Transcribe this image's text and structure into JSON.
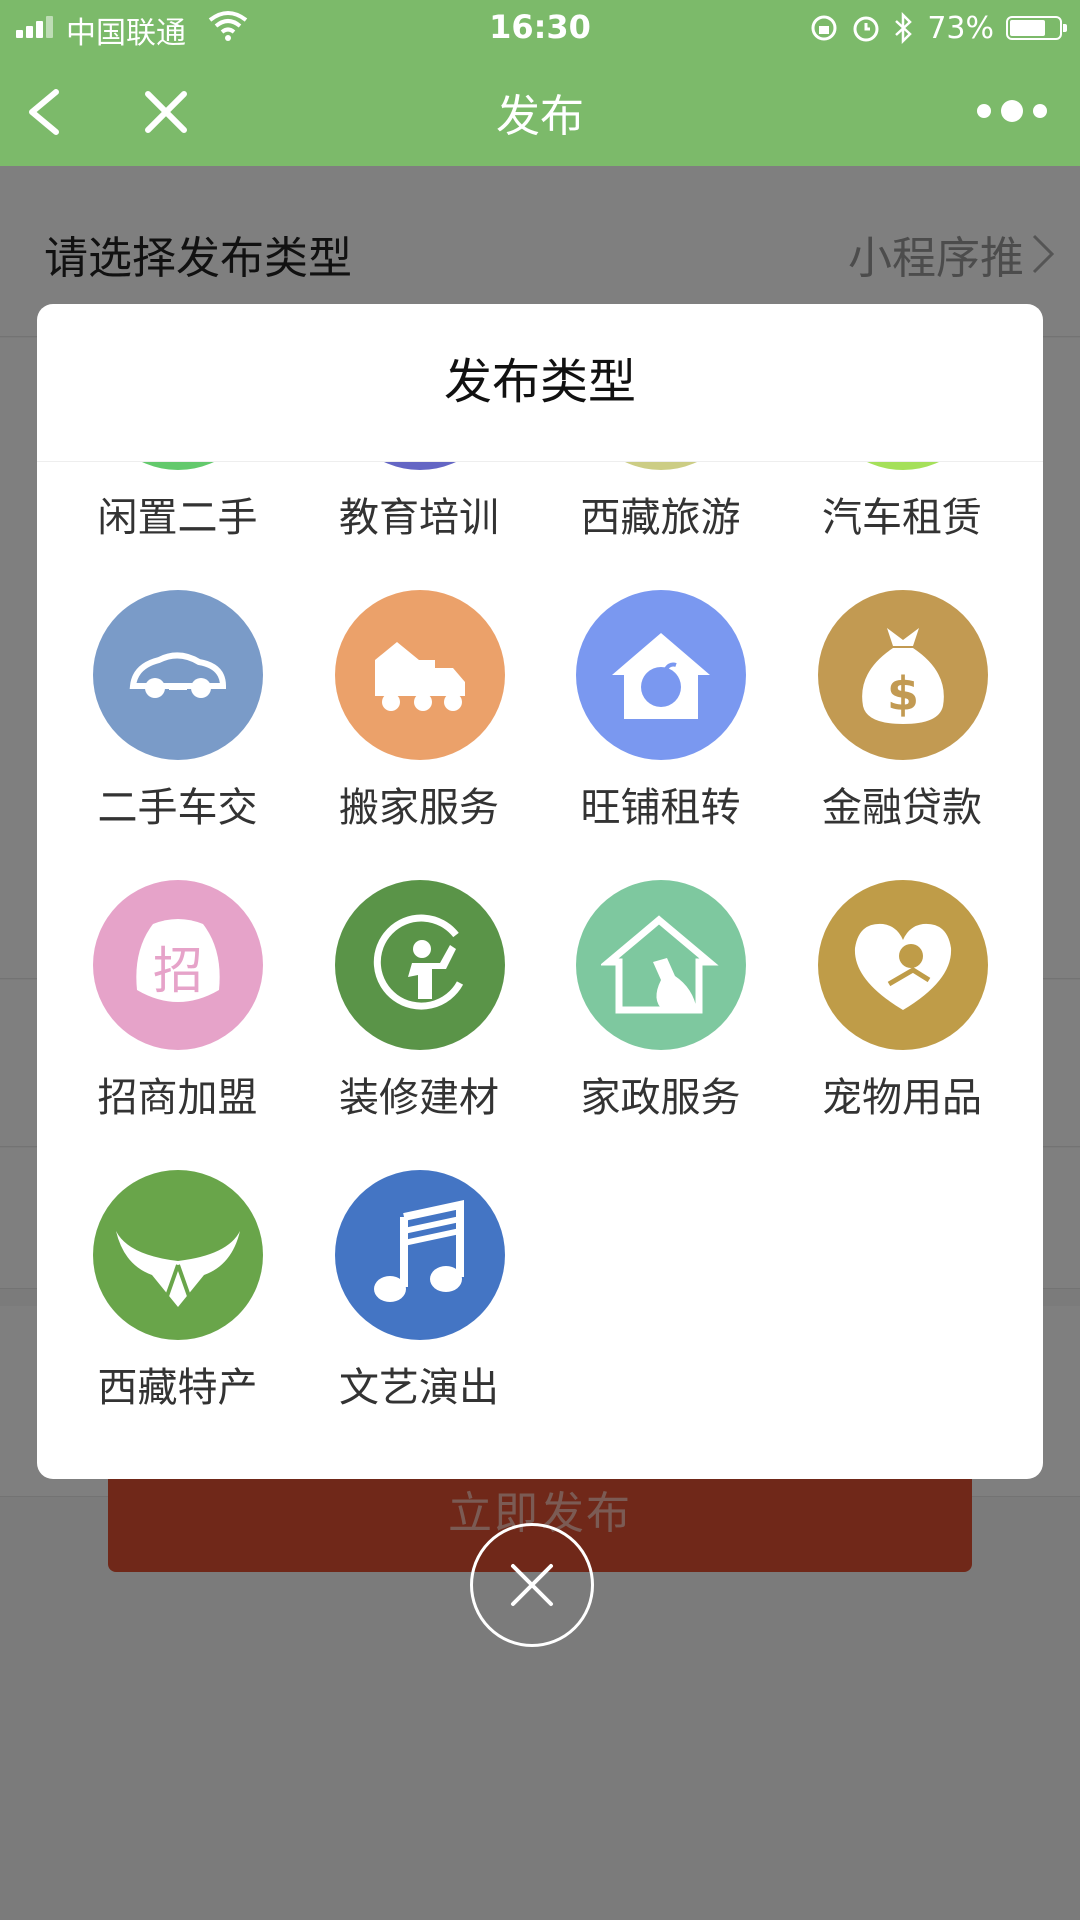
{
  "status_bar": {
    "carrier": "中国联通",
    "time": "16:30",
    "battery_percent": "73%",
    "battery_level": 0.73
  },
  "nav": {
    "title": "发布"
  },
  "form": {
    "type_label": "请选择发布类型",
    "type_value": "小程序推",
    "submit_label": "立即发布"
  },
  "modal": {
    "title": "发布类型",
    "categories": [
      {
        "label": "闲置二手",
        "icon": "secondhand-icon",
        "color": "#63c96c"
      },
      {
        "label": "教育培训",
        "icon": "education-icon",
        "color": "#6466c4"
      },
      {
        "label": "西藏旅游",
        "icon": "tibet-travel-icon",
        "color": "#cccd85"
      },
      {
        "label": "汽车租赁",
        "icon": "car-rental-icon",
        "color": "#a5e05a"
      },
      {
        "label": "二手车交",
        "icon": "car-icon",
        "color": "#7a9bc8"
      },
      {
        "label": "搬家服务",
        "icon": "moving-truck-icon",
        "color": "#eba16a"
      },
      {
        "label": "旺铺租转",
        "icon": "shop-house-icon",
        "color": "#7a98f0"
      },
      {
        "label": "金融贷款",
        "icon": "money-bag-icon",
        "color": "#c29a52"
      },
      {
        "label": "招商加盟",
        "icon": "zhao-badge-icon",
        "color": "#e6a3c9",
        "glyph": "招"
      },
      {
        "label": "装修建材",
        "icon": "renovation-icon",
        "color": "#5a9448"
      },
      {
        "label": "家政服务",
        "icon": "housekeeping-icon",
        "color": "#7ec89f"
      },
      {
        "label": "宠物用品",
        "icon": "pet-heart-icon",
        "color": "#bf9c48"
      },
      {
        "label": "西藏特产",
        "icon": "tibet-specialty-icon",
        "color": "#69a54a"
      },
      {
        "label": "文艺演出",
        "icon": "music-note-icon",
        "color": "#4475c4"
      }
    ]
  },
  "colors": {
    "header_green": "#7cba6a",
    "publish_red": "#e05032"
  }
}
